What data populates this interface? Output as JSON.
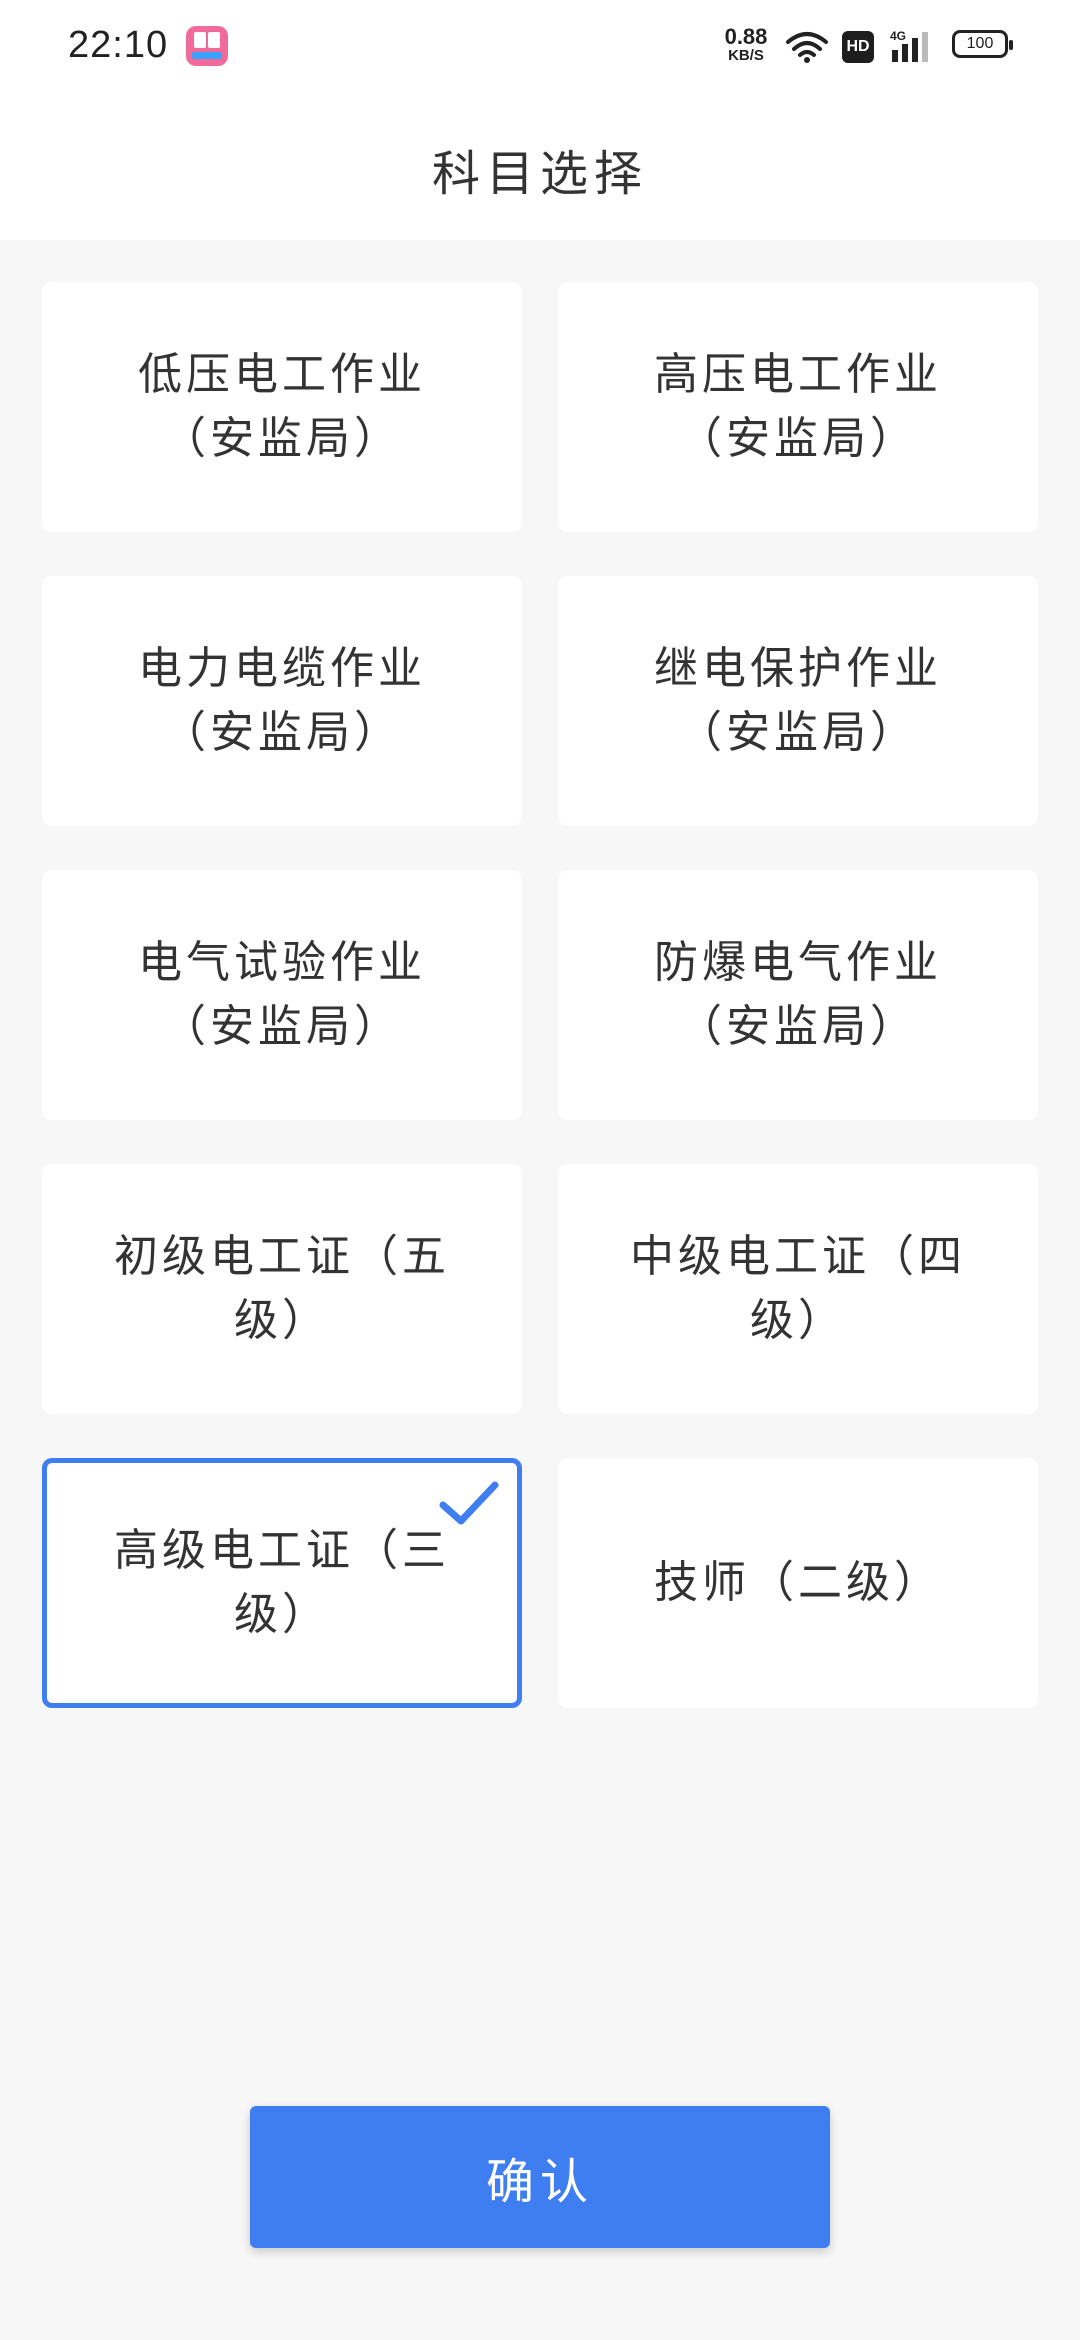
{
  "status_bar": {
    "time": "22:10",
    "net_speed_value": "0.88",
    "net_speed_unit": "KB/S",
    "hd_label": "HD",
    "network_type": "4G",
    "battery": "100"
  },
  "header": {
    "title": "科目选择"
  },
  "subjects": [
    {
      "label": "低压电工作业（安监局）",
      "selected": false
    },
    {
      "label": "高压电工作业（安监局）",
      "selected": false
    },
    {
      "label": "电力电缆作业（安监局）",
      "selected": false
    },
    {
      "label": "继电保护作业（安监局）",
      "selected": false
    },
    {
      "label": "电气试验作业（安监局）",
      "selected": false
    },
    {
      "label": "防爆电气作业（安监局）",
      "selected": false
    },
    {
      "label": "初级电工证（五级）",
      "selected": false
    },
    {
      "label": "中级电工证（四级）",
      "selected": false
    },
    {
      "label": "高级电工证（三级）",
      "selected": true
    },
    {
      "label": "技师（二级）",
      "selected": false
    }
  ],
  "confirm_button": {
    "label": "确认"
  },
  "colors": {
    "accent": "#3f7ef0",
    "background": "#f7f7f7",
    "card": "#ffffff",
    "text": "#333333"
  }
}
